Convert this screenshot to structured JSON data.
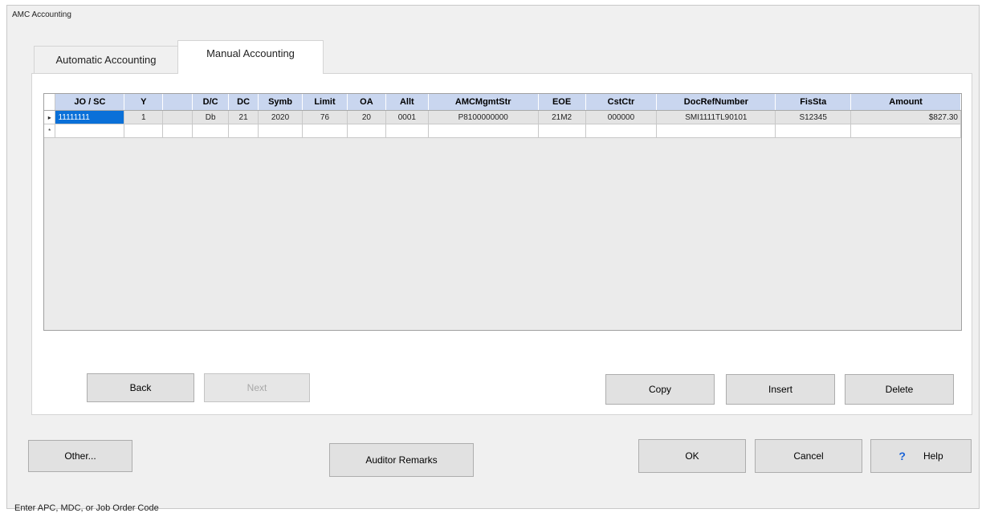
{
  "window": {
    "title": "AMC Accounting"
  },
  "tabs": [
    {
      "label": "Automatic Accounting",
      "active": false
    },
    {
      "label": "Manual Accounting",
      "active": true
    }
  ],
  "grid": {
    "columns": [
      "JO / SC",
      "Y",
      "",
      "D/C",
      "DC",
      "Symb",
      "Limit",
      "OA",
      "Allt",
      "AMCMgmtStr",
      "EOE",
      "CstCtr",
      "DocRefNumber",
      "FisSta",
      "Amount"
    ],
    "rows": [
      [
        "11111111",
        "1",
        "",
        "Db",
        "21",
        "2020",
        "76",
        "20",
        "0001",
        "P8100000000",
        "21M2",
        "000000",
        "SMI1111TL90101",
        "S12345",
        "$827.30"
      ]
    ],
    "current_row_marker": "▸",
    "new_row_marker": "*"
  },
  "panel_buttons": {
    "back": "Back",
    "next": "Next",
    "copy": "Copy",
    "insert": "Insert",
    "delete": "Delete"
  },
  "bottom_buttons": {
    "other": "Other...",
    "auditor_remarks": "Auditor Remarks",
    "ok": "OK",
    "cancel": "Cancel",
    "help": "Help"
  },
  "icons": {
    "help": "help-question-icon"
  },
  "colors": {
    "selection": "#0a70d8",
    "header_bg": "#c9d6ef",
    "help_icon": "#1a63d6"
  },
  "status": {
    "text": "Enter APC, MDC, or Job Order Code"
  }
}
